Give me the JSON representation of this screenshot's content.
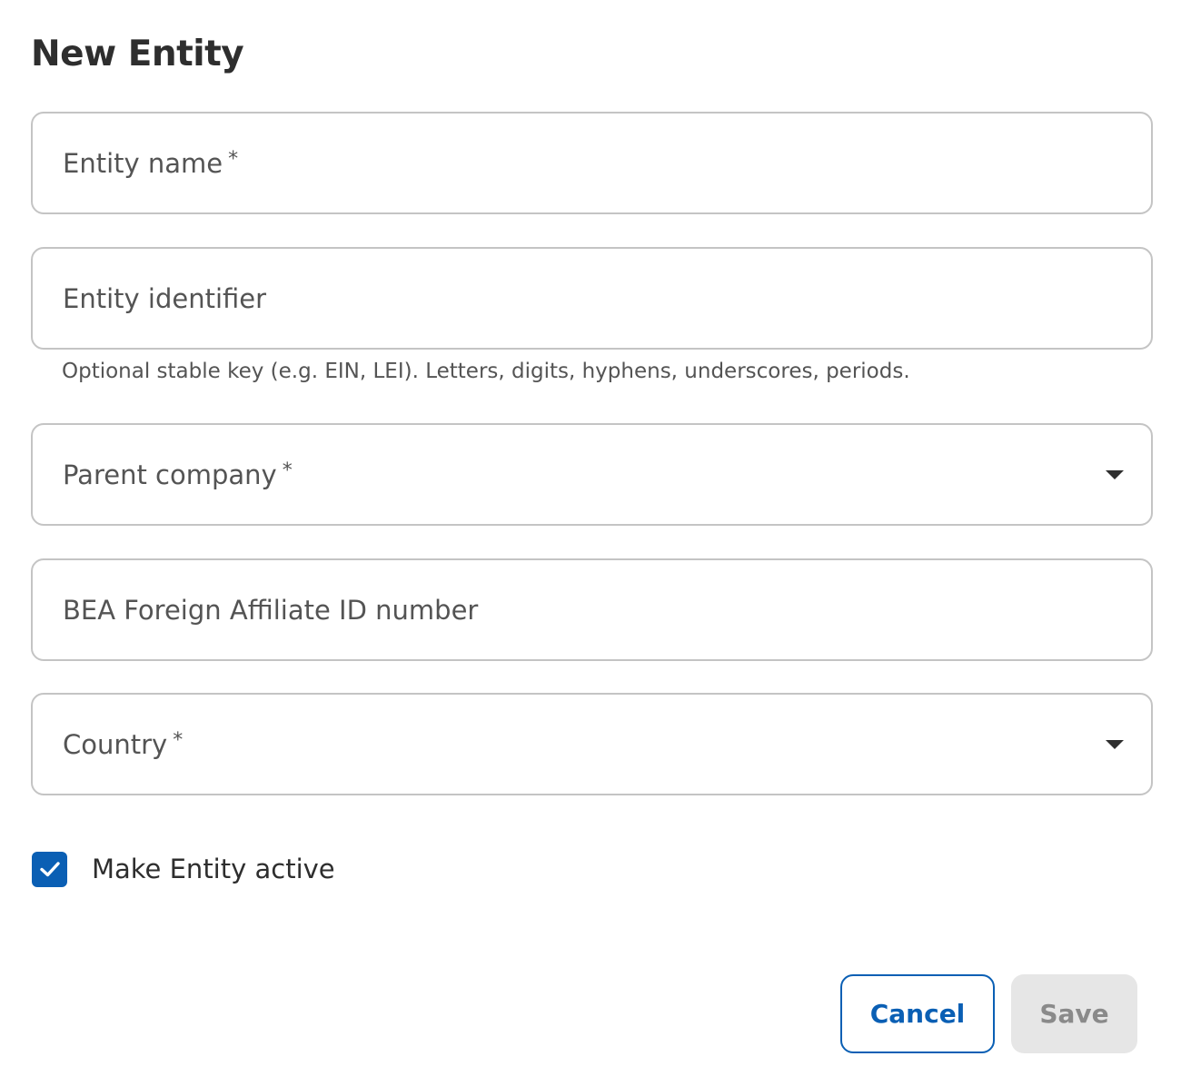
{
  "dialog": {
    "title": "New Entity"
  },
  "fields": {
    "entity_name": {
      "label": "Entity name",
      "required_mark": "*"
    },
    "entity_identifier": {
      "label": "Entity identifier",
      "helper": "Optional stable key (e.g. EIN, LEI). Letters, digits, hyphens, underscores, periods."
    },
    "parent_company": {
      "label": "Parent company",
      "required_mark": "*"
    },
    "bea_id": {
      "label": "BEA Foreign Affiliate ID number"
    },
    "country": {
      "label": "Country",
      "required_mark": "*"
    }
  },
  "active_checkbox": {
    "label": "Make Entity active",
    "checked": true
  },
  "actions": {
    "cancel_label": "Cancel",
    "save_label": "Save"
  },
  "colors": {
    "primary": "#0a5fb4",
    "border": "#c4c4c4",
    "text": "#2e2e2e",
    "muted_text": "#545454",
    "disabled_bg": "#e6e6e6",
    "disabled_text": "#8a8a8a"
  },
  "icons": {
    "dropdown": "caret-down-icon",
    "checkbox": "checkmark-icon"
  }
}
